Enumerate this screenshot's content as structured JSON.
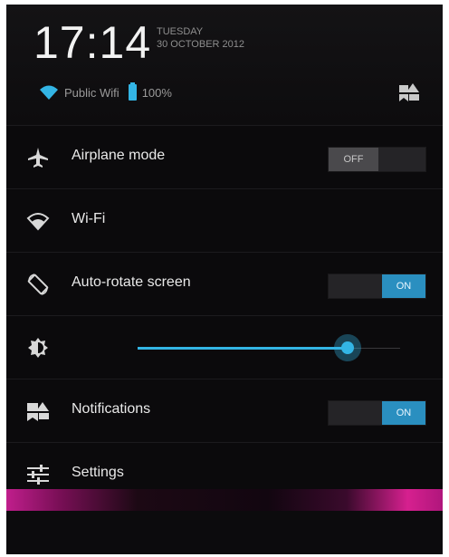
{
  "header": {
    "time": "17:14",
    "day": "TUESDAY",
    "date": "30 OCTOBER 2012",
    "wifi_name": "Public Wifi",
    "battery": "100%"
  },
  "settings": {
    "airplane": {
      "label": "Airplane mode",
      "toggle": "OFF"
    },
    "wifi": {
      "label": "Wi-Fi"
    },
    "rotate": {
      "label": "Auto-rotate screen",
      "toggle": "ON"
    },
    "brightness": {
      "level": 0.8
    },
    "notifications": {
      "label": "Notifications",
      "toggle": "ON"
    },
    "settings": {
      "label": "Settings"
    }
  },
  "colors": {
    "accent": "#33b5e5",
    "background": "#0b0a0c",
    "text": "#e9e9e9"
  },
  "icons": {
    "airplane": "airplane-icon",
    "wifi": "wifi-icon",
    "rotate": "rotate-icon",
    "brightness": "brightness-icon",
    "notifications": "notifications-icon",
    "settings": "settings-sliders-icon"
  }
}
